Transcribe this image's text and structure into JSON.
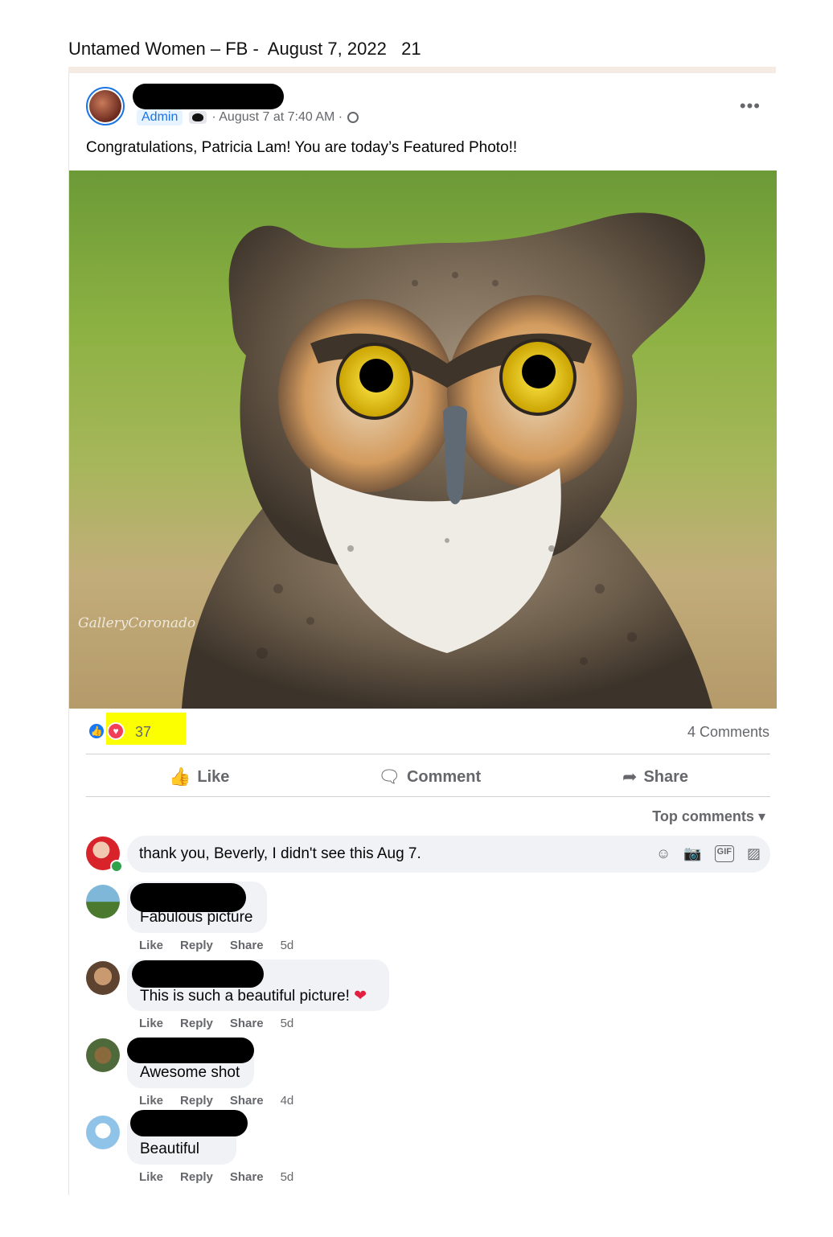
{
  "doc_header": {
    "title": "Untamed Women – FB -  August 7, 2022   21"
  },
  "post": {
    "admin_label": "Admin",
    "timestamp": "· August 7 at 7:40 AM ·",
    "caption": "Congratulations, Patricia Lam! You are today’s Featured Photo!!",
    "more_label": "•••",
    "photo_watermark": "GalleryCoronado"
  },
  "stats": {
    "reactions_count": "37",
    "comments_count": "4 Comments"
  },
  "actions": {
    "like": "Like",
    "comment": "Comment",
    "share": "Share"
  },
  "sort": {
    "label": "Top comments"
  },
  "composer": {
    "text": "thank you, Beverly, I didn't see this Aug 7."
  },
  "comments": [
    {
      "text": "Fabulous picture",
      "like": "Like",
      "reply": "Reply",
      "share": "Share",
      "time": "5d"
    },
    {
      "text": "This is such a beautiful picture!",
      "like": "Like",
      "reply": "Reply",
      "share": "Share",
      "time": "5d"
    },
    {
      "text": "Awesome shot",
      "like": "Like",
      "reply": "Reply",
      "share": "Share",
      "time": "4d"
    },
    {
      "text": "Beautiful",
      "like": "Like",
      "reply": "Reply",
      "share": "Share",
      "time": "5d"
    }
  ],
  "colors": {
    "accent": "#1877f2",
    "love": "#f33e58",
    "highlight": "#fcff00",
    "muted_text": "#65676b"
  }
}
